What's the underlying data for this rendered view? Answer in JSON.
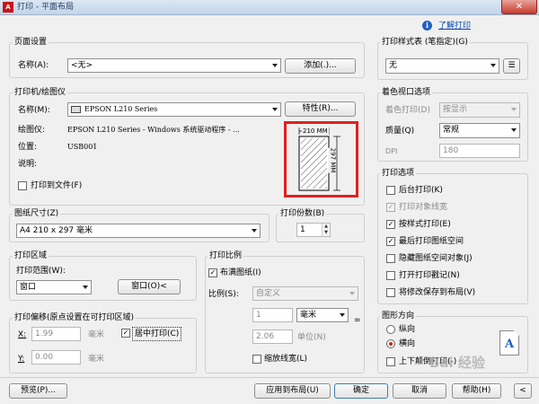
{
  "window": {
    "title": "打印 - 平面布局",
    "logo": "A",
    "close_glyph": "✕"
  },
  "help_link": "了解打印",
  "page_setup": {
    "group": "页面设置",
    "name_label": "名称(A):",
    "name_value": "<无>",
    "add_button": "添加(.)..."
  },
  "printer": {
    "group": "打印机/绘图仪",
    "name_label": "名称(M):",
    "name_value": "EPSON L210 Series",
    "props_button": "特性(R)...",
    "plotter_label": "绘图仪:",
    "plotter_value": "EPSON L210 Series - Windows 系统驱动程序 - ...",
    "location_label": "位置:",
    "location_value": "USB001",
    "desc_label": "说明:",
    "print_to_file": "打印到文件(F)",
    "preview_width_label": "210 MM",
    "preview_height_label": "297 MM"
  },
  "paper_size": {
    "group": "图纸尺寸(Z)",
    "value": "A4 210 x 297 毫米"
  },
  "copies": {
    "group": "打印份数(B)",
    "value": "1"
  },
  "print_area": {
    "group": "打印区域",
    "range_label": "打印范围(W):",
    "range_value": "窗口",
    "window_button": "窗口(O)<"
  },
  "print_offset": {
    "group": "打印偏移(原点设置在可打印区域)",
    "x_label": "X:",
    "x_value": "1.99",
    "y_label": "Y:",
    "y_value": "0.00",
    "unit": "毫米",
    "center_label": "居中打印(C)",
    "center_checked": true
  },
  "print_scale": {
    "group": "打印比例",
    "fit_label": "布满图纸(I)",
    "fit_checked": true,
    "scale_label": "比例(S):",
    "scale_value": "自定义",
    "value1": "1",
    "unit_value": "毫米",
    "value2": "2.06",
    "unit2_label": "单位(N)",
    "lineweights_label": "缩放线宽(L)"
  },
  "plot_style": {
    "group": "打印样式表 (笔指定)(G)",
    "value": "无"
  },
  "shaded_viewport": {
    "group": "着色视口选项",
    "shade_label": "着色打印(D)",
    "shade_value": "按显示",
    "quality_label": "质量(Q)",
    "quality_value": "常规",
    "dpi_label": "DPI",
    "dpi_value": "180"
  },
  "plot_options": {
    "group": "打印选项",
    "items": [
      {
        "label": "后台打印(K)",
        "checked": false,
        "disabled": false
      },
      {
        "label": "打印对象线宽",
        "checked": true,
        "disabled": true
      },
      {
        "label": "按样式打印(E)",
        "checked": true,
        "disabled": false
      },
      {
        "label": "最后打印图纸空间",
        "checked": true,
        "disabled": false
      },
      {
        "label": "隐藏图纸空间对象(J)",
        "checked": false,
        "disabled": false
      },
      {
        "label": "打开打印戳记(N)",
        "checked": false,
        "disabled": false
      },
      {
        "label": "将修改保存到布局(V)",
        "checked": false,
        "disabled": false
      }
    ]
  },
  "orientation": {
    "group": "图形方向",
    "portrait": "纵向",
    "landscape": "横向",
    "selected": "landscape",
    "upside_down": "上下颠倒打印(-)",
    "preview_letter": "A"
  },
  "footer": {
    "preview": "预览(P)...",
    "apply": "应用到布局(U)",
    "ok": "确定",
    "cancel": "取消",
    "help": "帮助(H)",
    "expand": "<"
  },
  "watermark": "Bai 经验",
  "colors": {
    "highlight_box": "#e02020",
    "title_bar": "#c3d4e8",
    "close_button": "#c63c2e"
  },
  "icons": {
    "info": "info-icon",
    "printer": "printer-icon",
    "pen_settings": "pen-settings-icon",
    "arrow_up": "arrow-up-icon",
    "orientation": "landscape-page-icon"
  }
}
